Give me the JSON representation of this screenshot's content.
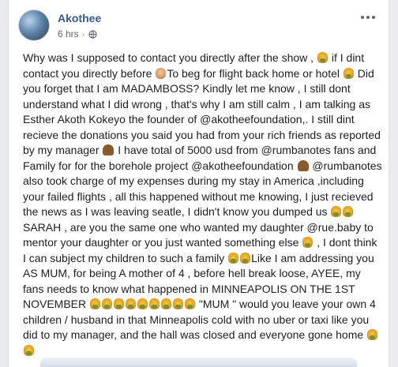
{
  "post": {
    "author": "Akothee",
    "time": "6 hrs",
    "privacy_separator": "·",
    "segments": [
      {
        "t": "Why was I supposed to contact you directly after the show , "
      },
      {
        "e": "emj"
      },
      {
        "t": " if I dint contact you directly before "
      },
      {
        "e": "person"
      },
      {
        "t": "To beg for flight back home or hotel "
      },
      {
        "e": "emj"
      },
      {
        "t": " Did you forget that I am MADAMBOSS? Kindly let me know , I still dont understand what I did wrong , that's why I am still calm , I am talking as Esther Akoth Kokeyo the founder of @akotheefoundation,. I still dint recieve the donations you said you had from your rich friends as reported by my manager "
      },
      {
        "e": "pray"
      },
      {
        "t": " I have total of 5000 usd from @rumbanotes fans and Family for for the borehole project @akotheefoundation "
      },
      {
        "e": "pray"
      },
      {
        "t": " @rumbanotes also took charge of my expenses during my stay in America ,including your failed flights , all this happened without me knowing, I just recieved the news as I was leaving seatle, I didn't know you dumped us "
      },
      {
        "e": "emj"
      },
      {
        "e": "emj"
      },
      {
        "t": " SARAH , are you the same one who wanted my daughter @rue.baby to mentor your daughter or you just wanted something else "
      },
      {
        "e": "emj"
      },
      {
        "t": " , I dont think I can subject my children to such a family "
      },
      {
        "e": "emj"
      },
      {
        "e": "emj"
      },
      {
        "t": "Like I am addressing you AS MUM, for being A mother of 4 , before hell break loose, AYEE, my fans needs to know what happened in MINNEAPOLIS ON THE 1ST NOVEMBER "
      },
      {
        "e": "emj"
      },
      {
        "e": "emj"
      },
      {
        "e": "emj"
      },
      {
        "e": "emj"
      },
      {
        "e": "emj"
      },
      {
        "e": "emj"
      },
      {
        "e": "emj"
      },
      {
        "e": "emj"
      },
      {
        "e": "emj"
      },
      {
        "t": " \"MUM \" would you leave your own 4 children / husband in that Minneapolis cold with no uber or taxi like you did to my manager, and the hall was closed and everyone gone home "
      },
      {
        "e": "emj"
      },
      {
        "e": "emj"
      }
    ]
  },
  "icons": {
    "globe": "globe-icon",
    "more": "more-options-icon"
  },
  "colors": {
    "author": "#365899",
    "meta": "#616770",
    "text": "#1c1e21",
    "background": "#e9ebee"
  }
}
